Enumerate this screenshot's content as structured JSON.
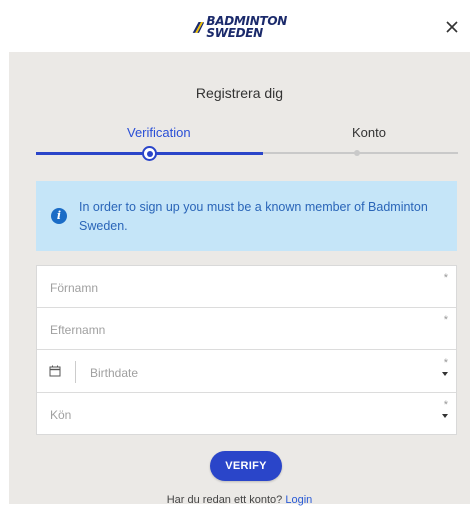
{
  "brand": {
    "line1": "BADMINTON",
    "line2": "SWEDEN",
    "color": "#1b2a6b",
    "icon": "badminton-sweden-logo"
  },
  "dialog": {
    "close_icon": "close-icon"
  },
  "title": "Registrera dig",
  "steps": [
    {
      "label": "Verification",
      "active": true
    },
    {
      "label": "Konto",
      "active": false
    }
  ],
  "info": {
    "icon": "info-icon",
    "text": "In order to sign up you must be a known member of Badminton Sweden."
  },
  "form": {
    "first_name": {
      "placeholder": "Förnamn",
      "required_mark": "*"
    },
    "last_name": {
      "placeholder": "Efternamn",
      "required_mark": "*"
    },
    "birthdate": {
      "placeholder": "Birthdate",
      "required_mark": "*",
      "icon": "calendar-icon"
    },
    "gender": {
      "placeholder": "Kön",
      "required_mark": "*"
    }
  },
  "verify_label": "VERIFY",
  "login": {
    "prompt": "Har du redan ett konto?",
    "link": "Login"
  },
  "colors": {
    "accent": "#2a45c9",
    "info_bg": "#c5e5f8",
    "panel_bg": "#ebe9e6"
  }
}
